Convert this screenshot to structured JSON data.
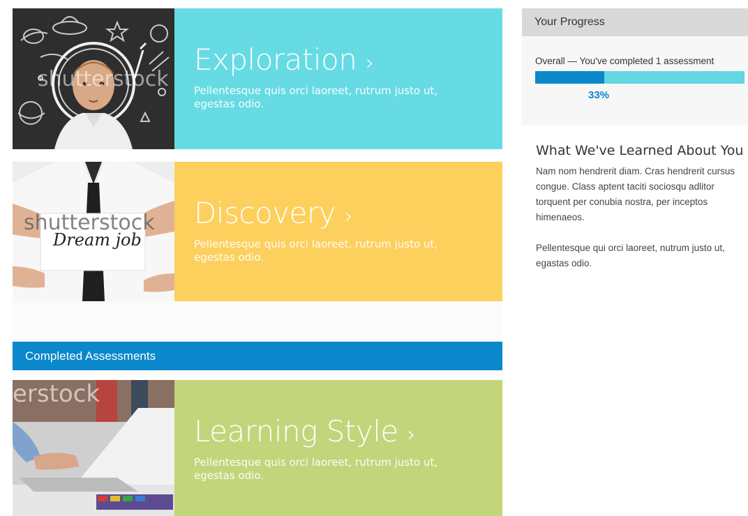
{
  "cards": [
    {
      "title": "Exploration",
      "arrow": "›",
      "desc": "Pellentesque quis orci laoreet, rutrum justo ut, egestas odio.",
      "color": "#66dbe3",
      "image_watermark": "shutterstock"
    },
    {
      "title": "Discovery",
      "arrow": "›",
      "desc": "Pellentesque quis orci laoreet, rutrum justo ut, egestas odio.",
      "color": "#fdcf5d",
      "image_watermark": "shutterstock",
      "image_card_text": "Dream job"
    },
    {
      "title": "Learning Style",
      "arrow": "›",
      "desc": "Pellentesque quis orci laoreet, rutrum justo ut, egestas odio.",
      "color": "#c3d57a",
      "image_watermark": "erstock"
    }
  ],
  "completed_section": {
    "label": "Completed Assessments",
    "color": "#0b87cb"
  },
  "progress": {
    "header": "Your Progress",
    "overall_text": "Overall — You've completed 1 assessment",
    "percent_label": "33%",
    "fraction": 0.33,
    "track_color": "#63d7e2",
    "fill_color": "#0b87cb"
  },
  "learned": {
    "title": "What We've Learned About You",
    "paragraph1": "Nam nom hendrerit diam. Cras hendrerit cursus congue. Class aptent taciti sociosqu adlitor torquent per conubia nostra, per inceptos himenaeos.",
    "paragraph2": "Pellentesque qui orci laoreet, nutrum justo ut, egastas odio."
  }
}
